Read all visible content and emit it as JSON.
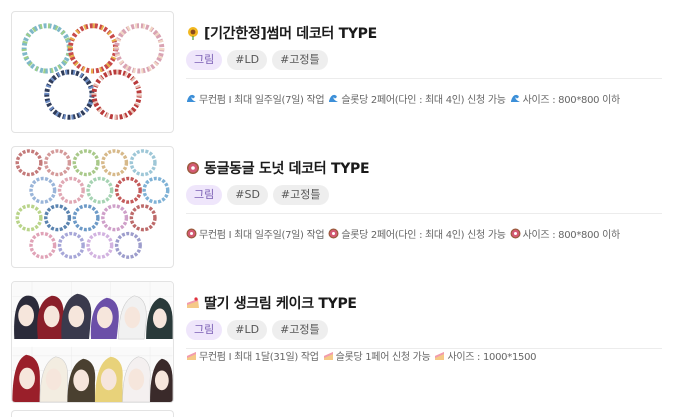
{
  "products": [
    {
      "title": "[기간한정]썸머 데코터 TYPE",
      "icon": "sunflower-icon",
      "tags": [
        "그림",
        "#LD",
        "#고정틀"
      ],
      "details": [
        "무컨펌 I 최대 일주일(7일) 작업",
        "슬롯당 2페어(다인 : 최대 4인) 신청 가능",
        "사이즈 : 800*800 이하"
      ],
      "detail_icon": "wave-icon"
    },
    {
      "title": "동글동글 도넛 데코터 TYPE",
      "icon": "donut-icon",
      "tags": [
        "그림",
        "#SD",
        "#고정틀"
      ],
      "details": [
        "무컨펌 I 최대 일주일(7일) 작업",
        "슬롯당 2페어(다인 : 최대 4인) 신청 가능",
        "사이즈 : 800*800 이하"
      ],
      "detail_icon": "donut-icon"
    },
    {
      "title": "딸기 생크림 케이크 TYPE",
      "icon": "cake-slice-icon",
      "tags": [
        "그림",
        "#LD",
        "#고정틀"
      ],
      "details": [
        "무컨펌 I 최대 1달(31일) 작업",
        "슬롯당 1페어 신청 가능",
        "사이즈 : 1000*1500"
      ],
      "detail_icon": "cake-slice-icon"
    }
  ],
  "colors": {
    "tag_primary_bg": "#efe6fb",
    "tag_primary_text": "#7b5fb5",
    "tag_bg": "#eeeeee",
    "border": "#e3e3e3"
  }
}
